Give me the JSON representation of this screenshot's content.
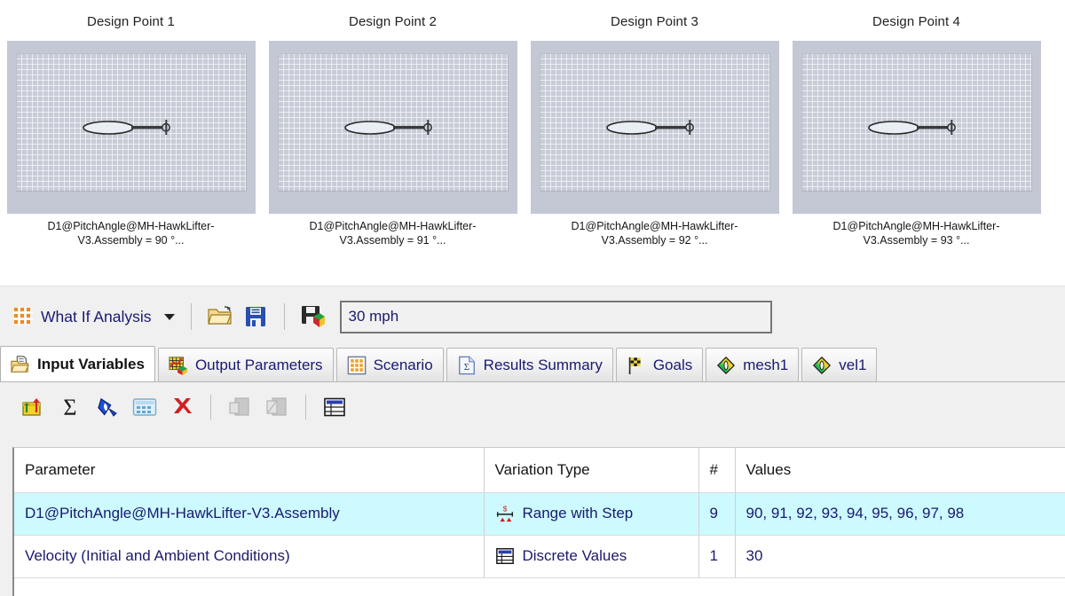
{
  "design_points": [
    {
      "title": "Design Point 1",
      "caption": "D1@PitchAngle@MH-HawkLifter-\nV3.Assembly =  90 °..."
    },
    {
      "title": "Design Point 2",
      "caption": "D1@PitchAngle@MH-HawkLifter-\nV3.Assembly =  91 °..."
    },
    {
      "title": "Design Point 3",
      "caption": "D1@PitchAngle@MH-HawkLifter-\nV3.Assembly =  92 °..."
    },
    {
      "title": "Design Point 4",
      "caption": "D1@PitchAngle@MH-HawkLifter-\nV3.Assembly =  93 °..."
    }
  ],
  "command_bar": {
    "what_if_label": "What If Analysis",
    "open_icon": "open-folder-icon",
    "save_icon": "save-floppy-icon",
    "export_icon": "save-export-icon",
    "value_field": "30 mph"
  },
  "tabs": [
    {
      "label": "Input Variables",
      "icon": "open-folder-document-icon",
      "active": true
    },
    {
      "label": "Output Parameters",
      "icon": "chart-box-icon",
      "active": false
    },
    {
      "label": "Scenario",
      "icon": "scenario-grid-icon",
      "active": false
    },
    {
      "label": "Results Summary",
      "icon": "sigma-document-icon",
      "active": false
    },
    {
      "label": "Goals",
      "icon": "checkered-flag-icon",
      "active": false
    },
    {
      "label": "mesh1",
      "icon": "rainbow-diamond-icon",
      "active": false
    },
    {
      "label": "vel1",
      "icon": "rainbow-diamond-icon",
      "active": false
    }
  ],
  "icon_toolbar": [
    {
      "name": "new-input-variable-icon",
      "enabled": true
    },
    {
      "name": "sum-sigma-icon",
      "enabled": true
    },
    {
      "name": "edit-diamond-icon",
      "enabled": true
    },
    {
      "name": "table-blue-icon",
      "enabled": true
    },
    {
      "name": "delete-red-x-icon",
      "enabled": true
    },
    {
      "name": "copy-panel-icon",
      "enabled": false
    },
    {
      "name": "paste-panel-icon",
      "enabled": false
    },
    {
      "name": "table-view-icon",
      "enabled": true
    }
  ],
  "table": {
    "columns": [
      "Parameter",
      "Variation Type",
      "#",
      "Values"
    ],
    "rows": [
      {
        "parameter": "D1@PitchAngle@MH-HawkLifter-V3.Assembly",
        "variation_type": "Range with Step",
        "variation_icon": "range-with-step-icon",
        "count": "9",
        "values": "90, 91, 92, 93, 94, 95, 96, 97, 98",
        "selected": true
      },
      {
        "parameter": "Velocity (Initial and Ambient Conditions)",
        "variation_type": "Discrete Values",
        "variation_icon": "discrete-values-icon",
        "count": "1",
        "values": "30",
        "selected": false
      }
    ]
  },
  "colors": {
    "selection": "#ccfaff",
    "panel_bg": "#f0f0f0",
    "thumb_bg": "#c3c8d4",
    "text_blue": "#1a1a6e",
    "accent_orange": "#f08a1e"
  }
}
